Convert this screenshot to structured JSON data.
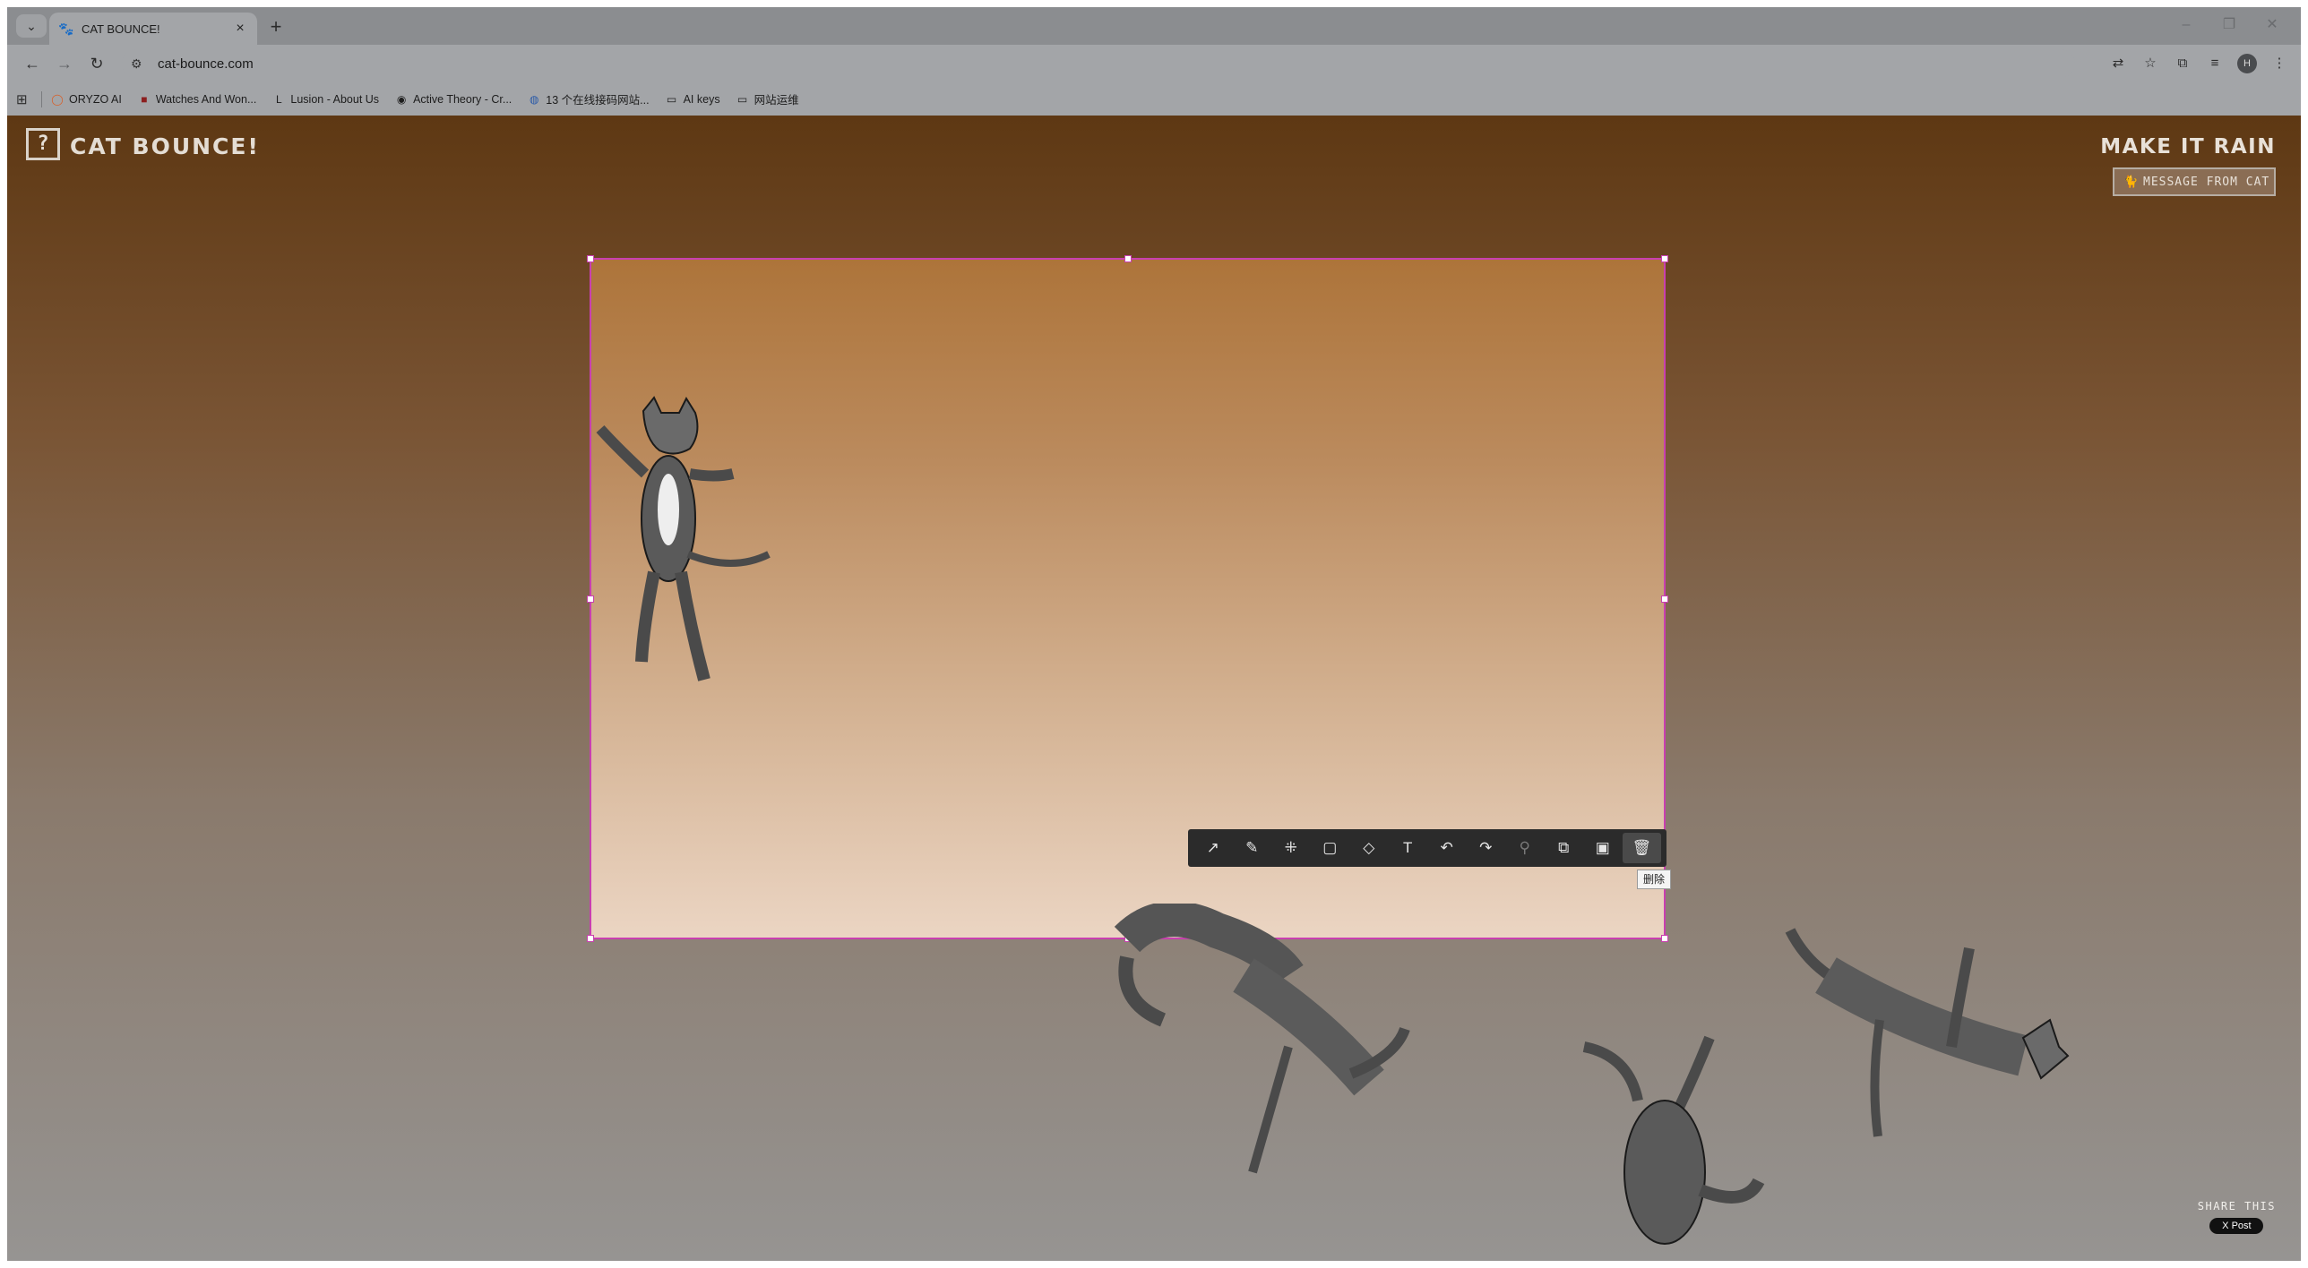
{
  "browser": {
    "tab_title": "CAT BOUNCE!",
    "url": "cat-bounce.com",
    "bookmarks": [
      {
        "label": "ORYZO AI",
        "icon": "circle-icon"
      },
      {
        "label": "Watches And Won...",
        "icon": "bookmark-favicon"
      },
      {
        "label": "Lusion - About Us",
        "icon": "bookmark-favicon"
      },
      {
        "label": "Active Theory - Cr...",
        "icon": "bookmark-favicon"
      },
      {
        "label": "13 个在线接码网站...",
        "icon": "bookmark-favicon"
      },
      {
        "label": "AI keys",
        "icon": "folder-icon"
      },
      {
        "label": "网站运维",
        "icon": "folder-icon"
      }
    ],
    "avatar_initial": "H"
  },
  "page": {
    "help_label": "?",
    "brand": "CAT BOUNCE!",
    "make_it_rain": "MAKE IT RAIN",
    "message_button": "MESSAGE FROM CAT",
    "share_label": "SHARE THIS",
    "post_button": "X Post"
  },
  "snip_toolbar": {
    "tools": [
      "arrow-icon",
      "pen-icon",
      "mosaic-icon",
      "rectangle-icon",
      "eraser-icon",
      "text-icon",
      "undo-icon",
      "redo-icon",
      "pin-icon",
      "copy-icon",
      "save-icon",
      "delete-icon"
    ],
    "tooltip": "删除"
  },
  "colors": {
    "selection_border": "#c93fb0",
    "page_top": "#5e3813",
    "page_bottom": "#969492"
  }
}
